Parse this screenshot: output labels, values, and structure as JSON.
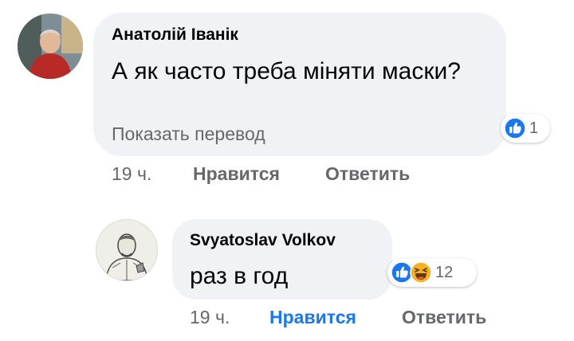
{
  "comment1": {
    "author": "Анатолій Іванік",
    "text": "А як часто треба міняти маски?",
    "translate_label": "Показать перевод",
    "reactions": {
      "icons": [
        "like-icon"
      ],
      "count": "1"
    },
    "time": "19 ч.",
    "like_label": "Нравится",
    "reply_label": "Ответить"
  },
  "comment2": {
    "author": "Svyatoslav Volkov",
    "text": "раз в год",
    "reactions": {
      "icons": [
        "like-icon",
        "haha-icon"
      ],
      "count": "12"
    },
    "time": "19 ч.",
    "like_label": "Нравится",
    "like_active": true,
    "reply_label": "Ответить"
  },
  "colors": {
    "bubble": "#f0f2f5",
    "secondary_text": "#65676b",
    "like_blue": "#1877f2",
    "haha_yellow": "#f7b125"
  }
}
